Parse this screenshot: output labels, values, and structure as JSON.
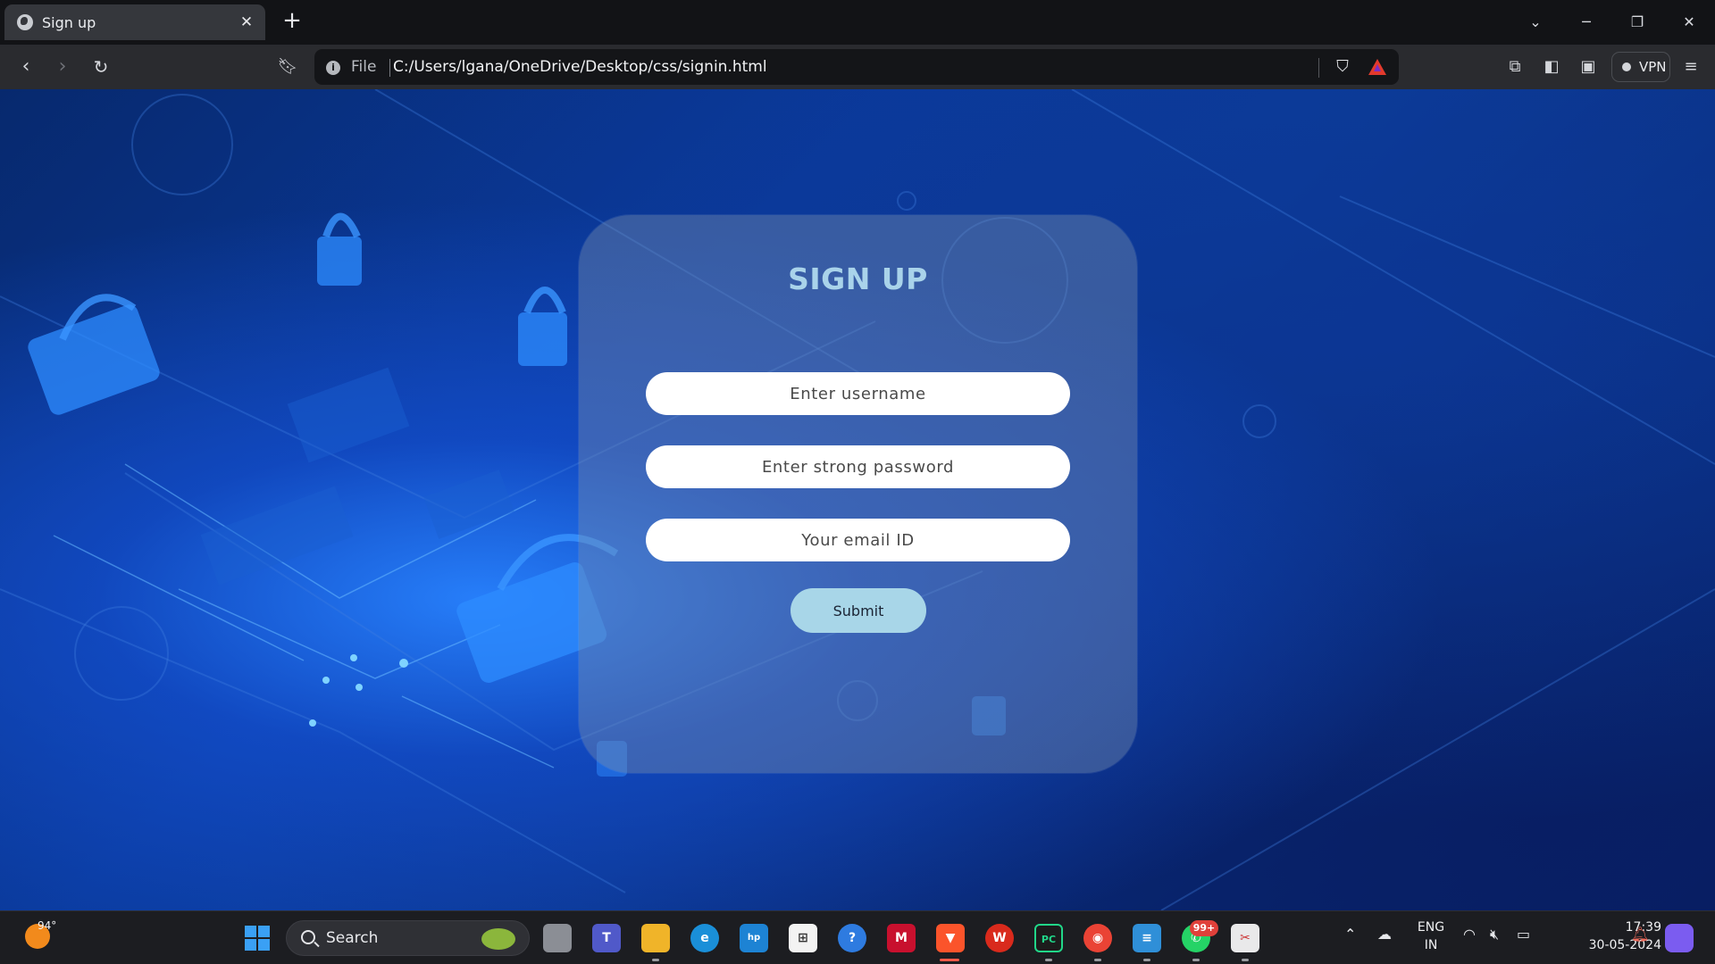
{
  "browser": {
    "tab_title": "Sign up",
    "tab_close": "✕",
    "new_tab": "+",
    "address_scheme": "File",
    "address_url": "C:/Users/lgana/OneDrive/Desktop/css/signin.html",
    "vpn_label": "VPN"
  },
  "form": {
    "heading": "SIGN UP",
    "username_placeholder": "Enter username",
    "password_placeholder": "Enter strong password",
    "email_placeholder": "Your email ID",
    "submit_label": "Submit"
  },
  "taskbar": {
    "weather_temp": "94°",
    "search_label": "Search",
    "whatsapp_badge": "99+",
    "lang_line1": "ENG",
    "lang_line2": "IN",
    "time": "17:39",
    "date": "30-05-2024"
  }
}
